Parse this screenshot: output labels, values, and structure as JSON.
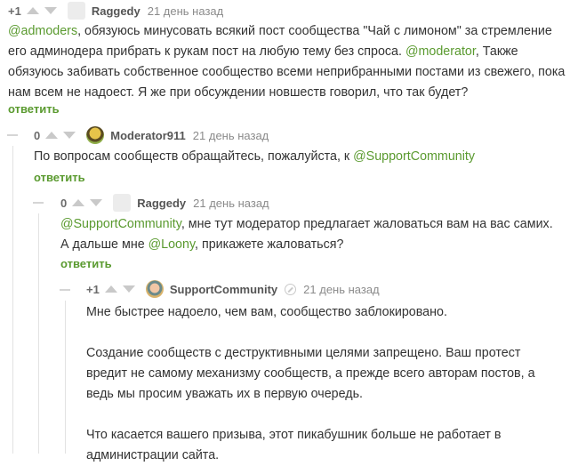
{
  "comments": [
    {
      "score": "+1",
      "author": "Raggedy",
      "time": "21 день назад",
      "body": [
        {
          "m": "@admoders"
        },
        {
          "t": ", обязуюсь минусовать всякий пост сообщества \"Чай с лимоном\" за стремление его админодера прибрать к рукам пост на любую тему без спроса. "
        },
        {
          "m": "@moderator"
        },
        {
          "t": ", Также обязуюсь забивать собственное сообщество всеми неприбранными постами из свежего, пока нам всем не надоест. Я же при обсуждении новшеств говорил, что так будет?"
        }
      ],
      "reply": "ответить"
    },
    {
      "score": "0",
      "author": "Moderator911",
      "time": "21 день назад",
      "body": [
        {
          "t": "По вопросам сообществ обращайтесь, пожалуйста, к "
        },
        {
          "m": "@SupportCommunity"
        }
      ],
      "reply": "ответить"
    },
    {
      "score": "0",
      "author": "Raggedy",
      "time": "21 день назад",
      "body": [
        {
          "m": "@SupportCommunity"
        },
        {
          "t": ", мне тут модератор предлагает жаловаться вам на вас самих. А дальше мне "
        },
        {
          "m": "@Loony"
        },
        {
          "t": ", прикажете жаловаться?"
        }
      ],
      "reply": "ответить"
    },
    {
      "score": "+1",
      "author": "SupportCommunity",
      "time": "21 день назад",
      "paragraphs": [
        "Мне быстрее надоело, чем вам, сообщество заблокировано.",
        "Создание сообществ с деструктивными целями запрещено. Ваш протест вредит не самому механизму сообществ, а прежде всего авторам постов, а ведь мы просим уважать их в первую очередь.",
        "Что касается вашего призыва, этот пикабушник больше не работает в администрации сайта."
      ]
    }
  ]
}
